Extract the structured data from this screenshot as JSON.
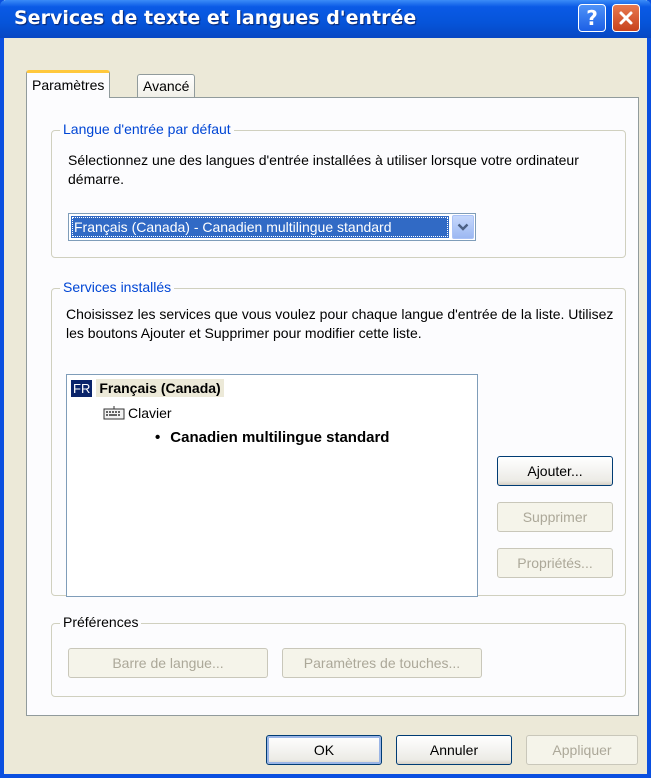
{
  "window": {
    "title": "Services de texte et langues d'entrée"
  },
  "tabs": [
    {
      "label": "Paramètres"
    },
    {
      "label": "Avancé"
    }
  ],
  "default_language": {
    "legend": "Langue d'entrée par défaut",
    "description": "Sélectionnez une des langues d'entrée installées à utiliser lorsque votre ordinateur démarre.",
    "selected": "Français (Canada) - Canadien multilingue standard"
  },
  "installed_services": {
    "legend": "Services installés",
    "description": "Choisissez les services que vous voulez pour chaque langue d'entrée de la liste. Utilisez les boutons Ajouter et Supprimer pour modifier cette liste.",
    "tree": {
      "language_code": "FR",
      "language": "Français (Canada)",
      "category": "Clavier",
      "layout": "Canadien multilingue standard"
    },
    "buttons": {
      "add": "Ajouter...",
      "remove": "Supprimer",
      "properties": "Propriétés..."
    }
  },
  "preferences": {
    "legend": "Préférences",
    "buttons": {
      "language_bar": "Barre de langue...",
      "key_settings": "Paramètres de touches..."
    }
  },
  "footer": {
    "ok": "OK",
    "cancel": "Annuler",
    "apply": "Appliquer"
  },
  "colors": {
    "title_bar": "#0654d9",
    "dialog": "#ece9d8",
    "selection": "#316ac5",
    "legend_text": "#0046d5"
  },
  "icons": [
    "help-icon",
    "close-icon",
    "chevron-down-icon",
    "keyboard-icon"
  ]
}
